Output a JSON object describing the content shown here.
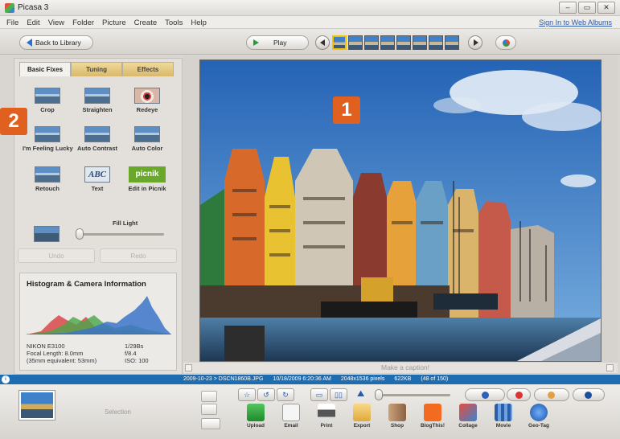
{
  "window": {
    "title": "Picasa 3",
    "controls": [
      "–",
      "▭",
      "✕"
    ]
  },
  "menu": {
    "items": [
      "File",
      "Edit",
      "View",
      "Folder",
      "Picture",
      "Create",
      "Tools",
      "Help"
    ],
    "sign_in": "Sign In to Web Albums"
  },
  "toolbar": {
    "back_label": "Back to Library",
    "play_label": "Play"
  },
  "tabs": [
    "Basic Fixes",
    "Tuning",
    "Effects"
  ],
  "basic_fixes": {
    "tools": [
      "Crop",
      "Straighten",
      "Redeye",
      "I'm Feeling Lucky",
      "Auto Contrast",
      "Auto Color",
      "Retouch",
      "Text",
      "Edit in Picnik"
    ],
    "text_icon": "ABC",
    "picnik_icon": "picnik",
    "fill_light_label": "Fill Light",
    "fill_light_value": 0,
    "undo_label": "Undo",
    "redo_label": "Redo"
  },
  "histogram": {
    "title": "Histogram & Camera Information",
    "camera_lines": [
      "NIKON E3100",
      "Focal Length: 8.0mm",
      "(35mm equivalent: 53mm)"
    ],
    "exposure_lines": [
      "1/29Bs",
      "f/8.4",
      "ISO: 100"
    ]
  },
  "badges": {
    "photo": "1",
    "panel": "2"
  },
  "viewer": {
    "caption_placeholder": "Make a caption!"
  },
  "status": {
    "date_file": "2009-10-23 > DSCN1860B.JPG",
    "timestamp": "10/18/2009 6:20:36 AM",
    "dimensions": "2048x1536 pixels",
    "size": "622KB",
    "position": "(48 of 150)"
  },
  "tray": {
    "selection_label": "Selection"
  },
  "actions": [
    "Upload",
    "Email",
    "Print",
    "Export",
    "Shop",
    "BlogThis!",
    "Collage",
    "Movie",
    "Geo-Tag"
  ],
  "colors": {
    "accent_blue": "#1f6db1",
    "badge_orange": "#e0601f",
    "picnik_green": "#6aa82b"
  }
}
